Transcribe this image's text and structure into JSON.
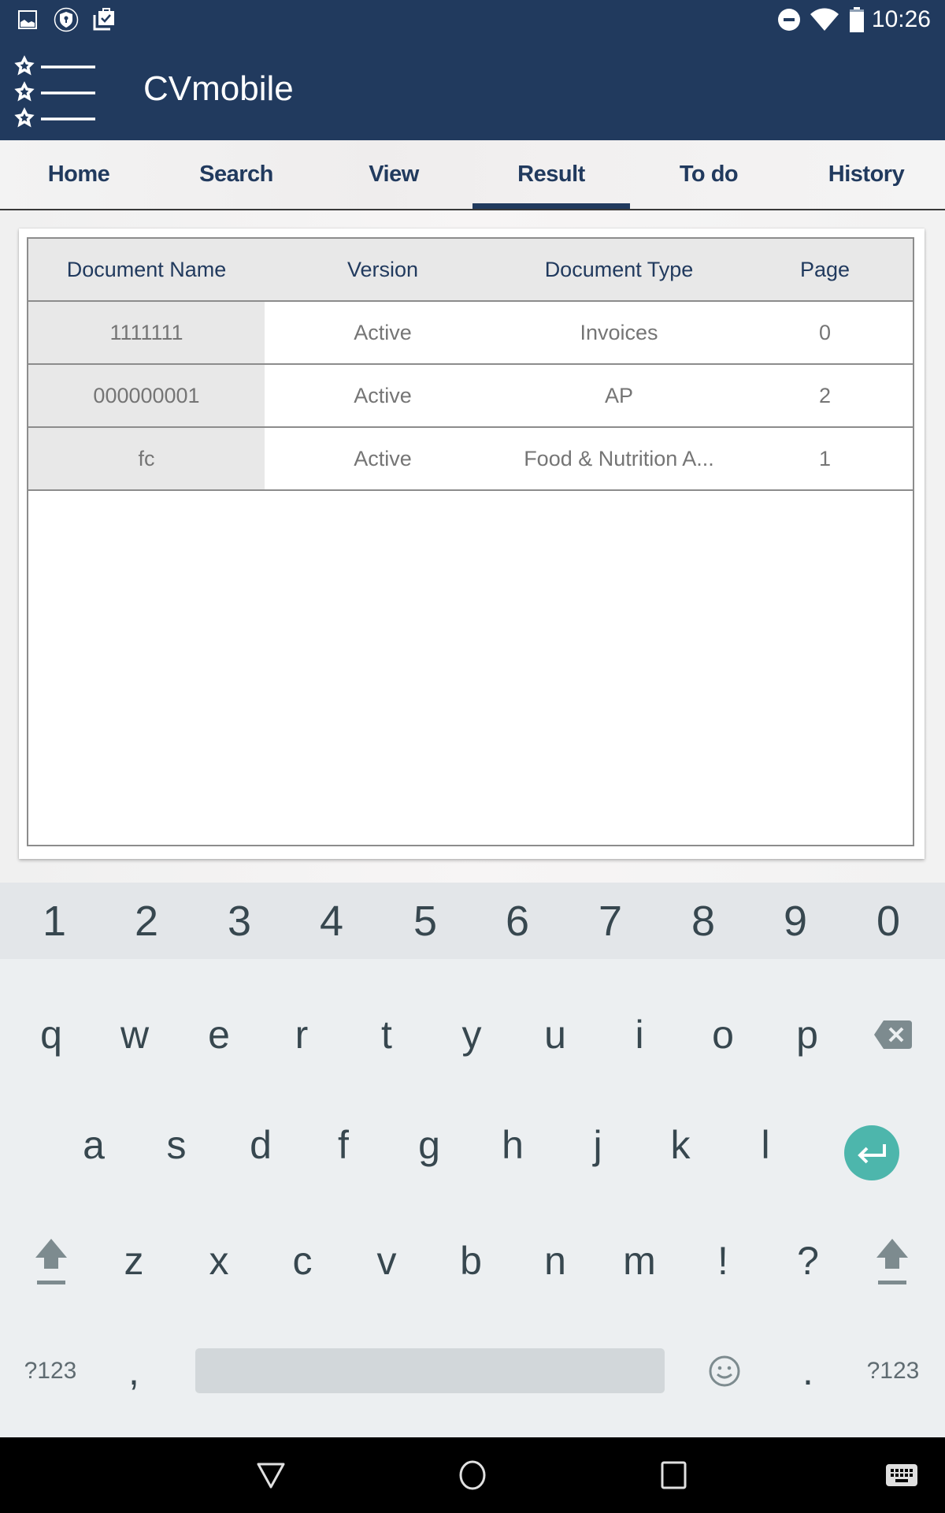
{
  "status_bar": {
    "time": "10:26",
    "left_icons": [
      "image-icon",
      "vpn-shield-icon",
      "clipboard-check-icon"
    ],
    "right_icons": [
      "do-not-disturb-icon",
      "wifi-icon",
      "battery-icon"
    ]
  },
  "app_bar": {
    "title": "CVmobile",
    "menu_icon": "starred-list-menu-icon"
  },
  "tabs": [
    {
      "label": "Home",
      "active": false
    },
    {
      "label": "Search",
      "active": false
    },
    {
      "label": "View",
      "active": false
    },
    {
      "label": "Result",
      "active": true
    },
    {
      "label": "To do",
      "active": false
    },
    {
      "label": "History",
      "active": false
    }
  ],
  "results_table": {
    "columns": [
      "Document Name",
      "Version",
      "Document Type",
      "Page"
    ],
    "rows": [
      [
        "1111111",
        "Active",
        "Invoices",
        "0"
      ],
      [
        "000000001",
        "Active",
        "AP",
        "2"
      ],
      [
        "fc",
        "Active",
        "Food & Nutrition A...",
        "1"
      ]
    ]
  },
  "keyboard": {
    "number_row": [
      "1",
      "2",
      "3",
      "4",
      "5",
      "6",
      "7",
      "8",
      "9",
      "0"
    ],
    "row1": [
      "q",
      "w",
      "e",
      "r",
      "t",
      "y",
      "u",
      "i",
      "o",
      "p"
    ],
    "row2": [
      "a",
      "s",
      "d",
      "f",
      "g",
      "h",
      "j",
      "k",
      "l"
    ],
    "row3": [
      "z",
      "x",
      "c",
      "v",
      "b",
      "n",
      "m",
      "!",
      "?"
    ],
    "bottom_row": {
      "symbols_left": "?123",
      "comma": ",",
      "period": ".",
      "symbols_right": "?123"
    },
    "enter_color": "#4db6ac"
  },
  "colors": {
    "primary": "#213a5e",
    "key_text": "#37474f"
  }
}
